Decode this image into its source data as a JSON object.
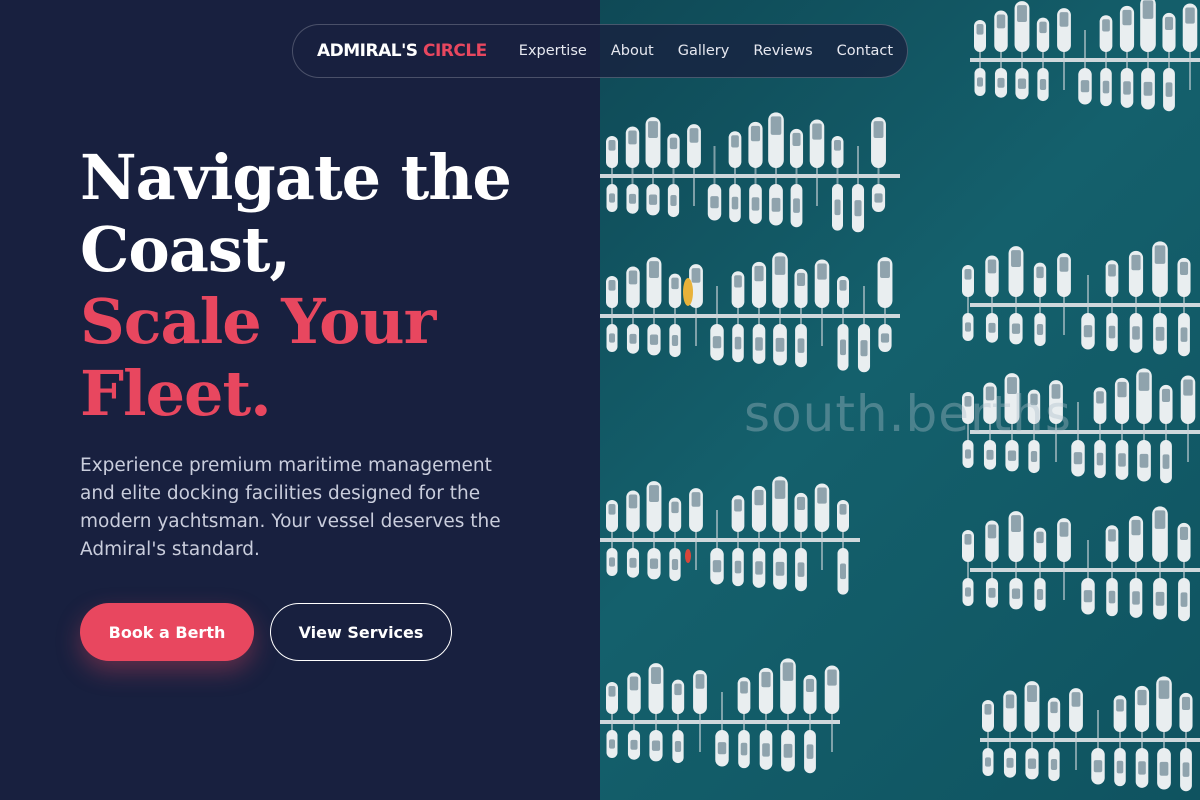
{
  "brand": {
    "logo_primary": "ADMIRAL'S",
    "logo_accent": "CIRCLE",
    "accent_color": "#e8475f",
    "background_color": "#18203f"
  },
  "nav": {
    "items": [
      {
        "label": "Expertise"
      },
      {
        "label": "About"
      },
      {
        "label": "Gallery"
      },
      {
        "label": "Reviews"
      },
      {
        "label": "Contact"
      }
    ]
  },
  "hero": {
    "title_line1": "Navigate the",
    "title_line2": "Coast,",
    "title_accent_line1": "Scale Your",
    "title_accent_line2": "Fleet.",
    "description": "Experience premium maritime management and elite docking facilities designed for the modern yachtsman. Your vessel deserves the Admiral's standard.",
    "primary_button": "Book a Berth",
    "secondary_button": "View Services"
  },
  "image": {
    "watermark": "south.berths"
  }
}
